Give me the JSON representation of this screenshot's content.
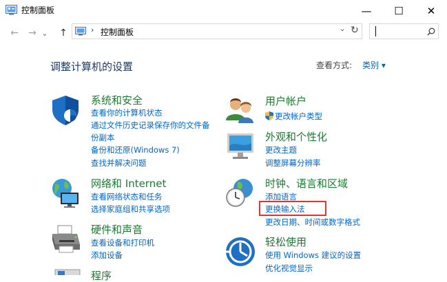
{
  "window": {
    "title": "控制面板",
    "minimize_glyph": "—",
    "maximize_glyph": "☐",
    "close_glyph": "✕"
  },
  "nav": {
    "back_glyph": "←",
    "forward_glyph": "→",
    "dropdown_glyph": "⌄",
    "up_glyph": "↑"
  },
  "address": {
    "separator": "›",
    "path": "控制面板",
    "dropdown_glyph": "⌄",
    "refresh_glyph": "↻"
  },
  "search": {
    "placeholder": "",
    "icon_glyph": "⌕"
  },
  "page": {
    "heading": "调整计算机的设置",
    "view_by_label": "查看方式:",
    "view_by_value": "类别 ▾"
  },
  "categories": {
    "system": {
      "title": "系统和安全",
      "icon": "shield-icon",
      "links": [
        "查看你的计算机状态",
        "通过文件历史记录保存你的文件备",
        "份副本",
        "备份和还原(Windows 7)",
        "查找并解决问题"
      ]
    },
    "network": {
      "title": "网络和 Internet",
      "icon": "network-globe-icon",
      "links": [
        "查看网络状态和任务",
        "选择家庭组和共享选项"
      ]
    },
    "hardware": {
      "title": "硬件和声音",
      "icon": "printer-icon",
      "links": [
        "查看设备和打印机",
        "添加设备"
      ]
    },
    "programs": {
      "title": "程序",
      "icon": "programs-icon",
      "links": []
    },
    "users": {
      "title": "用户帐户",
      "icon": "users-icon",
      "links": [
        "更改帐户类型"
      ]
    },
    "appearance": {
      "title": "外观和个性化",
      "icon": "monitor-icon",
      "links": [
        "更改主题",
        "调整屏幕分辨率"
      ]
    },
    "clock": {
      "title": "时钟、语言和区域",
      "icon": "clock-globe-icon",
      "links": [
        "添加语言",
        "更换输入法",
        "更改日期、时间或数字格式"
      ]
    },
    "ease": {
      "title": "轻松使用",
      "icon": "ease-of-access-icon",
      "links": [
        "使用 Windows 建议的设置",
        "优化视觉显示"
      ]
    }
  },
  "colors": {
    "category_title": "#1e7a32",
    "link": "#0066cc",
    "highlight_box": "#d5392f",
    "heading": "#1e395b"
  }
}
